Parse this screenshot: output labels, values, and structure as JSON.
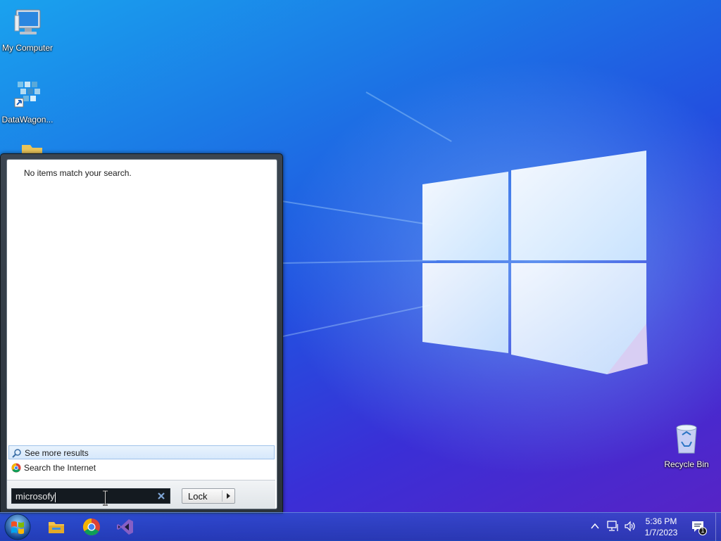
{
  "desktop": {
    "icons": [
      {
        "label": "My Computer",
        "icon": "computer-icon"
      },
      {
        "label": "DataWagon...",
        "icon": "datawagon-shortcut-icon"
      },
      {
        "label": "",
        "icon": "folder-icon"
      },
      {
        "label": "Recycle Bin",
        "icon": "recycle-bin-icon"
      }
    ]
  },
  "start_menu": {
    "no_results_text": "No items match your search.",
    "see_more_label": "See more results",
    "search_internet_label": "Search the Internet",
    "search_query": "microsofy",
    "power_button_label": "Lock"
  },
  "taskbar": {
    "pinned": [
      "file-explorer-icon",
      "chrome-icon",
      "visual-studio-icon"
    ],
    "clock_time": "5:36 PM",
    "clock_date": "1/7/2023",
    "notification_count": "1"
  },
  "colors": {
    "wallpaper_top": "#1aa2ee",
    "wallpaper_bottom": "#5a22c4",
    "highlight": "#d6e8fb",
    "search_box_bg": "#141a20"
  }
}
